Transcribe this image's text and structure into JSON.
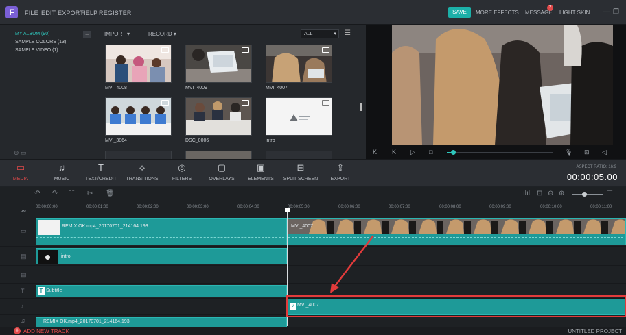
{
  "app": {
    "logo_letter": "F"
  },
  "menu": [
    "FILE",
    "EDIT",
    "EXPORT",
    "HELP",
    "REGISTER"
  ],
  "topright": {
    "save": "SAVE",
    "more_effects": "MORE EFFECTS",
    "message": "MESSAGE",
    "message_badge": "2",
    "light_skin": "LIGHT SKIN"
  },
  "album": {
    "items": [
      "MY ALBUM (90)",
      "SAMPLE COLORS (13)",
      "SAMPLE VIDEO (1)"
    ]
  },
  "media_toolbar": {
    "import": "IMPORT",
    "record": "RECORD",
    "filter": "ALL"
  },
  "thumbs": [
    {
      "label": "MVI_4008",
      "kind": "video"
    },
    {
      "label": "MVI_4009",
      "kind": "video"
    },
    {
      "label": "MVI_4007",
      "kind": "video"
    },
    {
      "label": "MVI_3864",
      "kind": "video"
    },
    {
      "label": "DSC_0006",
      "kind": "video"
    },
    {
      "label": "intro",
      "kind": "video"
    }
  ],
  "toolbar": {
    "items": [
      {
        "label": "MEDIA",
        "icon": "folder-icon",
        "active": true
      },
      {
        "label": "MUSIC",
        "icon": "music-note-icon",
        "active": false
      },
      {
        "label": "TEXT/CREDIT",
        "icon": "text-icon",
        "active": false
      },
      {
        "label": "TRANSITIONS",
        "icon": "transition-icon",
        "active": false
      },
      {
        "label": "FILTERS",
        "icon": "filter-icon",
        "active": false
      },
      {
        "label": "OVERLAYS",
        "icon": "overlay-icon",
        "active": false
      },
      {
        "label": "ELEMENTS",
        "icon": "image-icon",
        "active": false
      },
      {
        "label": "SPLIT SCREEN",
        "icon": "split-screen-icon",
        "active": false
      },
      {
        "label": "EXPORT",
        "icon": "export-icon",
        "active": false
      }
    ],
    "aspect": "ASPECT RATIO: 16:9",
    "timecode": "00:00:05.00"
  },
  "ruler": [
    "00:00:00:00",
    "00:00:01:00",
    "00:00:02:00",
    "00:00:03:00",
    "00:00:04:00",
    "00:00:05:00",
    "00:00:06:00",
    "00:00:07:00",
    "00:00:08:00",
    "00:00:09:00",
    "00:00:10:00",
    "00:00:11:00"
  ],
  "clips": {
    "video1": "REMIX OK.mp4_20170701_214164.193",
    "video2": "MVI_4007",
    "pip": "intro",
    "text": "Subtitle",
    "audio": "MVI_4007",
    "bottom": "REMIX OK.mp4_20170701_214164.193"
  },
  "bottom": {
    "add_track": "ADD NEW TRACK",
    "project": "UNTITLED PROJECT"
  }
}
